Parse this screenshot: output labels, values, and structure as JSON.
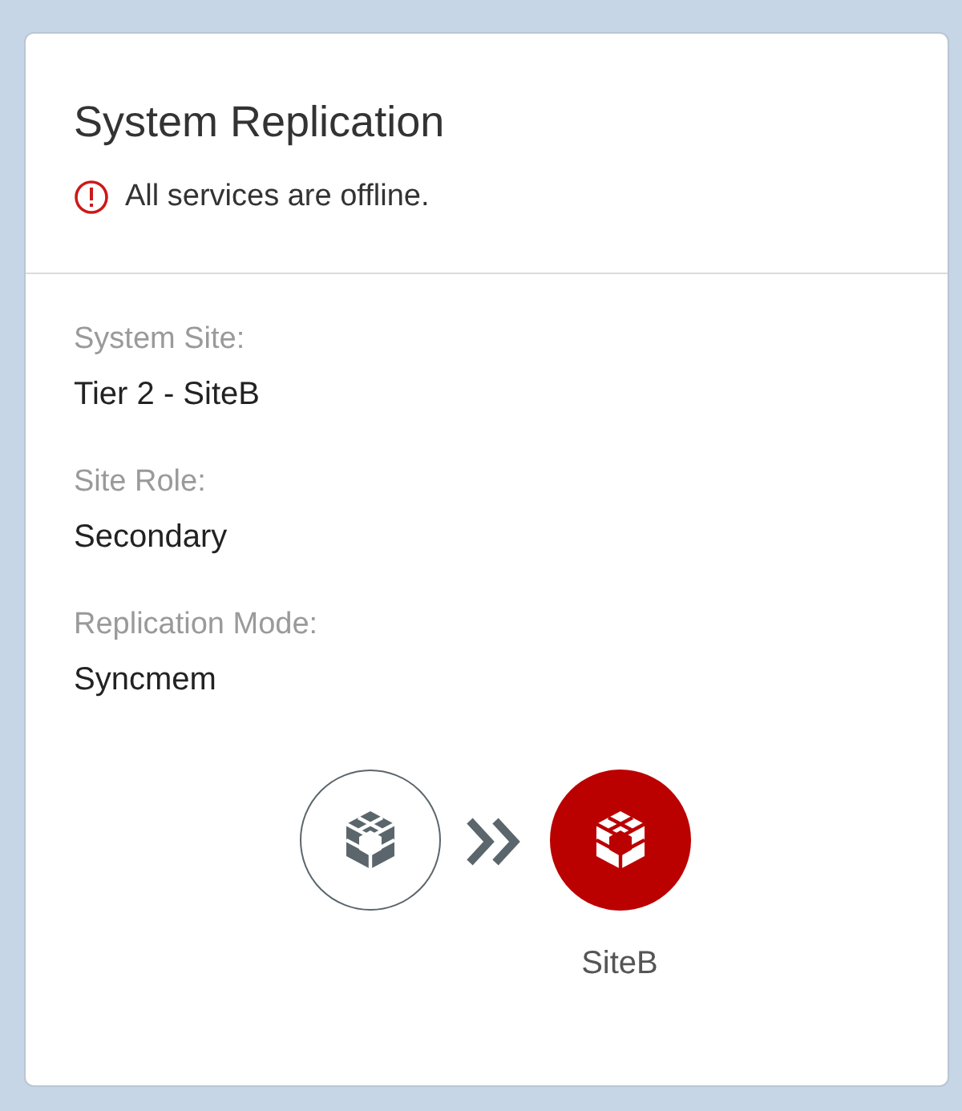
{
  "card": {
    "title": "System Replication",
    "status": {
      "kind": "error",
      "message": "All services are offline."
    },
    "fields": [
      {
        "label": "System Site:",
        "value": "Tier 2 - SiteB"
      },
      {
        "label": "Site Role:",
        "value": "Secondary"
      },
      {
        "label": "Replication Mode:",
        "value": "Syncmem"
      }
    ],
    "sites": [
      {
        "kind": "neutral"
      },
      {
        "kind": "error",
        "label": "SiteB"
      }
    ]
  }
}
